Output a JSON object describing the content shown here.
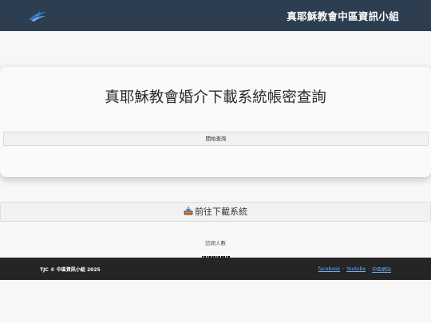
{
  "header": {
    "title": "真耶穌教會中區資訊小組",
    "logo_icon": "dove-logo-icon"
  },
  "card": {
    "title": "真耶穌教會婚介下載系統帳密查詢",
    "query_button": "開始查詢"
  },
  "download_button": {
    "icon": "inbox-tray-icon",
    "label": "前往下載系統"
  },
  "visitors": {
    "label": "訪問人數",
    "digits": [
      "0",
      "0",
      "1",
      "6",
      "7",
      "0"
    ]
  },
  "footer": {
    "copyright": "TJC © 中區資訊小組 2025",
    "links": [
      "facebook",
      "Youtube",
      "中區網站"
    ],
    "separator": "·"
  },
  "colors": {
    "header_bg": "#2d3e50",
    "footer_bg": "#252525",
    "link": "#6ab0f3"
  }
}
